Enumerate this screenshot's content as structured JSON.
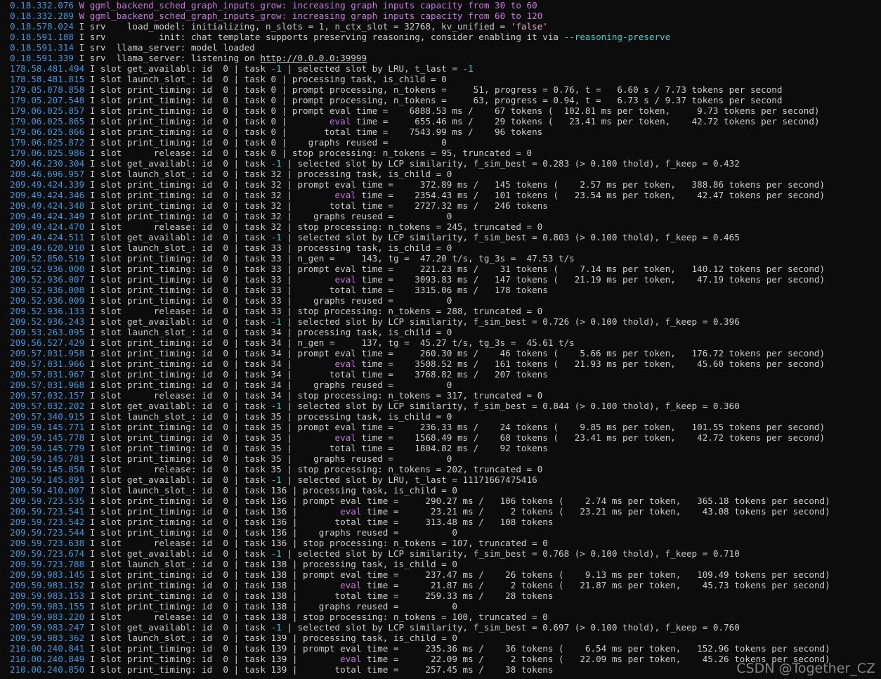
{
  "colors": {
    "background": "#0c0c0c",
    "timestamp": "#3a96dd",
    "warning": "#c678dd",
    "string_literal": "#f0a8c8",
    "keyword_cyan": "#3fd0d0",
    "text": "#cccccc"
  },
  "lines": [
    {
      "ts": "0.18.332.076",
      "lvl": "W",
      "segs": [
        {
          "t": " ggml_backend_sched_graph_inputs_grow: increasing graph inputs capacity from 30 to 60",
          "c": "warn"
        }
      ]
    },
    {
      "ts": "0.18.332.289",
      "lvl": "W",
      "segs": [
        {
          "t": " ggml_backend_sched_graph_inputs_grow: increasing graph inputs capacity from 60 to 120",
          "c": "warn"
        }
      ]
    },
    {
      "ts": "0.18.578.024",
      "lvl": "I",
      "segs": [
        {
          "t": " srv    load_model: initializing, n_slots = 1, n_ctx_slot = 32768, kv_unified = "
        },
        {
          "t": "'false'",
          "c": "str"
        }
      ]
    },
    {
      "ts": "0.18.591.188",
      "lvl": "I",
      "segs": [
        {
          "t": " srv          init: chat template supports preserving reasoning, consider enabling it via "
        },
        {
          "t": "--reasoning-preserve",
          "c": "cyan"
        }
      ]
    },
    {
      "ts": "0.18.591.314",
      "lvl": "I",
      "segs": [
        {
          "t": " srv  llama_server: model loaded"
        }
      ]
    },
    {
      "ts": "0.18.591.339",
      "lvl": "I",
      "segs": [
        {
          "t": " srv  llama_server: listening on "
        },
        {
          "t": "http://0.0.0.0:39999",
          "c": "url"
        }
      ]
    },
    {
      "ts": "178.58.481.494",
      "lvl": "I",
      "segs": [
        {
          "t": " slot get_availabl: id  0 | task "
        },
        {
          "t": "-1",
          "c": "cyan"
        },
        {
          "t": " | selected slot by LRU, t_last = "
        },
        {
          "t": "-1",
          "c": "cyan"
        }
      ]
    },
    {
      "ts": "178.58.481.815",
      "lvl": "I",
      "segs": [
        {
          "t": " slot launch_slot_: id  0 | task 0 | processing task, is_child = 0"
        }
      ]
    },
    {
      "ts": "179.05.078.858",
      "lvl": "I",
      "segs": [
        {
          "t": " slot print_timing: id  0 | task 0 | prompt processing, n_tokens =     51, progress = 0.76, t =   6.60 s / 7.73 tokens per second"
        }
      ]
    },
    {
      "ts": "179.05.207.548",
      "lvl": "I",
      "segs": [
        {
          "t": " slot print_timing: id  0 | task 0 | prompt processing, n_tokens =     63, progress = 0.94, t =   6.73 s / 9.37 tokens per second"
        }
      ]
    },
    {
      "ts": "179.06.025.857",
      "lvl": "I",
      "segs": [
        {
          "t": " slot print_timing: id  0 | task 0 | prompt eval time =    6888.53 ms /    67 tokens (  102.81 ms per token,     9.73 tokens per second)"
        }
      ]
    },
    {
      "ts": "179.06.025.865",
      "lvl": "I",
      "segs": [
        {
          "t": " slot print_timing: id  0 | task 0 |        "
        },
        {
          "t": "eval",
          "c": "warn"
        },
        {
          "t": " time =     655.46 ms /    29 tokens (   23.41 ms per token,    42.72 tokens per second)"
        }
      ]
    },
    {
      "ts": "179.06.025.866",
      "lvl": "I",
      "segs": [
        {
          "t": " slot print_timing: id  0 | task 0 |       total time =    7543.99 ms /    96 tokens"
        }
      ]
    },
    {
      "ts": "179.06.025.872",
      "lvl": "I",
      "segs": [
        {
          "t": " slot print_timing: id  0 | task 0 |    graphs reused =          0"
        }
      ]
    },
    {
      "ts": "179.06.025.986",
      "lvl": "I",
      "segs": [
        {
          "t": " slot      release: id  0 | task 0 | stop processing: n_tokens = 95, truncated = 0"
        }
      ]
    },
    {
      "ts": "209.46.230.304",
      "lvl": "I",
      "segs": [
        {
          "t": " slot get_availabl: id  0 | task "
        },
        {
          "t": "-1",
          "c": "cyan"
        },
        {
          "t": " | selected slot by LCP similarity, f_sim_best = 0.283 (> 0.100 thold), f_keep = 0.432"
        }
      ]
    },
    {
      "ts": "209.46.696.957",
      "lvl": "I",
      "segs": [
        {
          "t": " slot launch_slot_: id  0 | task 32 | processing task, is_child = 0"
        }
      ]
    },
    {
      "ts": "209.49.424.339",
      "lvl": "I",
      "segs": [
        {
          "t": " slot print_timing: id  0 | task 32 | prompt eval time =     372.89 ms /   145 tokens (    2.57 ms per token,   388.86 tokens per second)"
        }
      ]
    },
    {
      "ts": "209.49.424.346",
      "lvl": "I",
      "segs": [
        {
          "t": " slot print_timing: id  0 | task 32 |        "
        },
        {
          "t": "eval",
          "c": "warn"
        },
        {
          "t": " time =    2354.43 ms /   101 tokens (   23.54 ms per token,    42.47 tokens per second)"
        }
      ]
    },
    {
      "ts": "209.49.424.348",
      "lvl": "I",
      "segs": [
        {
          "t": " slot print_timing: id  0 | task 32 |       total time =    2727.32 ms /   246 tokens"
        }
      ]
    },
    {
      "ts": "209.49.424.349",
      "lvl": "I",
      "segs": [
        {
          "t": " slot print_timing: id  0 | task 32 |    graphs reused =          0"
        }
      ]
    },
    {
      "ts": "209.49.424.470",
      "lvl": "I",
      "segs": [
        {
          "t": " slot      release: id  0 | task 32 | stop processing: n_tokens = 245, truncated = 0"
        }
      ]
    },
    {
      "ts": "209.49.424.511",
      "lvl": "I",
      "segs": [
        {
          "t": " slot get_availabl: id  0 | task "
        },
        {
          "t": "-1",
          "c": "cyan"
        },
        {
          "t": " | selected slot by LCP similarity, f_sim_best = 0.803 (> 0.100 thold), f_keep = 0.465"
        }
      ]
    },
    {
      "ts": "209.49.620.910",
      "lvl": "I",
      "segs": [
        {
          "t": " slot launch_slot_: id  0 | task 33 | processing task, is_child = 0"
        }
      ]
    },
    {
      "ts": "209.52.850.519",
      "lvl": "I",
      "segs": [
        {
          "t": " slot print_timing: id  0 | task 33 | n_gen =     143, tg =  47.20 t/s, tg_3s =  47.53 t/s"
        }
      ]
    },
    {
      "ts": "209.52.936.000",
      "lvl": "I",
      "segs": [
        {
          "t": " slot print_timing: id  0 | task 33 | prompt eval time =     221.23 ms /    31 tokens (    7.14 ms per token,   140.12 tokens per second)"
        }
      ]
    },
    {
      "ts": "209.52.936.007",
      "lvl": "I",
      "segs": [
        {
          "t": " slot print_timing: id  0 | task 33 |        "
        },
        {
          "t": "eval",
          "c": "warn"
        },
        {
          "t": " time =    3093.83 ms /   147 tokens (   21.19 ms per token,    47.19 tokens per second)"
        }
      ]
    },
    {
      "ts": "209.52.936.008",
      "lvl": "I",
      "segs": [
        {
          "t": " slot print_timing: id  0 | task 33 |       total time =    3315.06 ms /   178 tokens"
        }
      ]
    },
    {
      "ts": "209.52.936.009",
      "lvl": "I",
      "segs": [
        {
          "t": " slot print_timing: id  0 | task 33 |    graphs reused =          0"
        }
      ]
    },
    {
      "ts": "209.52.936.133",
      "lvl": "I",
      "segs": [
        {
          "t": " slot      release: id  0 | task 33 | stop processing: n_tokens = 288, truncated = 0"
        }
      ]
    },
    {
      "ts": "209.52.936.243",
      "lvl": "I",
      "segs": [
        {
          "t": " slot get_availabl: id  0 | task "
        },
        {
          "t": "-1",
          "c": "cyan"
        },
        {
          "t": " | selected slot by LCP similarity, f_sim_best = 0.726 (> 0.100 thold), f_keep = 0.396"
        }
      ]
    },
    {
      "ts": "209.53.263.095",
      "lvl": "I",
      "segs": [
        {
          "t": " slot launch_slot_: id  0 | task 34 | processing task, is_child = 0"
        }
      ]
    },
    {
      "ts": "209.56.527.429",
      "lvl": "I",
      "segs": [
        {
          "t": " slot print_timing: id  0 | task 34 | n_gen =     137, tg =  45.27 t/s, tg_3s =  45.61 t/s"
        }
      ]
    },
    {
      "ts": "209.57.031.958",
      "lvl": "I",
      "segs": [
        {
          "t": " slot print_timing: id  0 | task 34 | prompt eval time =     260.30 ms /    46 tokens (    5.66 ms per token,   176.72 tokens per second)"
        }
      ]
    },
    {
      "ts": "209.57.031.966",
      "lvl": "I",
      "segs": [
        {
          "t": " slot print_timing: id  0 | task 34 |        "
        },
        {
          "t": "eval",
          "c": "warn"
        },
        {
          "t": " time =    3508.52 ms /   161 tokens (   21.93 ms per token,    45.60 tokens per second)"
        }
      ]
    },
    {
      "ts": "209.57.031.967",
      "lvl": "I",
      "segs": [
        {
          "t": " slot print_timing: id  0 | task 34 |       total time =    3768.82 ms /   207 tokens"
        }
      ]
    },
    {
      "ts": "209.57.031.968",
      "lvl": "I",
      "segs": [
        {
          "t": " slot print_timing: id  0 | task 34 |    graphs reused =          0"
        }
      ]
    },
    {
      "ts": "209.57.032.157",
      "lvl": "I",
      "segs": [
        {
          "t": " slot      release: id  0 | task 34 | stop processing: n_tokens = 317, truncated = 0"
        }
      ]
    },
    {
      "ts": "209.57.032.202",
      "lvl": "I",
      "segs": [
        {
          "t": " slot get_availabl: id  0 | task "
        },
        {
          "t": "-1",
          "c": "cyan"
        },
        {
          "t": " | selected slot by LCP similarity, f_sim_best = 0.844 (> 0.100 thold), f_keep = 0.360"
        }
      ]
    },
    {
      "ts": "209.57.340.915",
      "lvl": "I",
      "segs": [
        {
          "t": " slot launch_slot_: id  0 | task 35 | processing task, is_child = 0"
        }
      ]
    },
    {
      "ts": "209.59.145.771",
      "lvl": "I",
      "segs": [
        {
          "t": " slot print_timing: id  0 | task 35 | prompt eval time =     236.33 ms /    24 tokens (    9.85 ms per token,   101.55 tokens per second)"
        }
      ]
    },
    {
      "ts": "209.59.145.778",
      "lvl": "I",
      "segs": [
        {
          "t": " slot print_timing: id  0 | task 35 |        "
        },
        {
          "t": "eval",
          "c": "warn"
        },
        {
          "t": " time =    1568.49 ms /    68 tokens (   23.41 ms per token,    42.72 tokens per second)"
        }
      ]
    },
    {
      "ts": "209.59.145.779",
      "lvl": "I",
      "segs": [
        {
          "t": " slot print_timing: id  0 | task 35 |       total time =    1804.82 ms /    92 tokens"
        }
      ]
    },
    {
      "ts": "209.59.145.781",
      "lvl": "I",
      "segs": [
        {
          "t": " slot print_timing: id  0 | task 35 |    graphs reused =          0"
        }
      ]
    },
    {
      "ts": "209.59.145.858",
      "lvl": "I",
      "segs": [
        {
          "t": " slot      release: id  0 | task 35 | stop processing: n_tokens = 202, truncated = 0"
        }
      ]
    },
    {
      "ts": "209.59.145.891",
      "lvl": "I",
      "segs": [
        {
          "t": " slot get_availabl: id  0 | task "
        },
        {
          "t": "-1",
          "c": "cyan"
        },
        {
          "t": " | selected slot by LRU, t_last = 11171667475416"
        }
      ]
    },
    {
      "ts": "209.59.410.007",
      "lvl": "I",
      "segs": [
        {
          "t": " slot launch_slot_: id  0 | task 136 | processing task, is_child = 0"
        }
      ]
    },
    {
      "ts": "209.59.723.535",
      "lvl": "I",
      "segs": [
        {
          "t": " slot print_timing: id  0 | task 136 | prompt eval time =     290.27 ms /   106 tokens (    2.74 ms per token,   365.18 tokens per second)"
        }
      ]
    },
    {
      "ts": "209.59.723.541",
      "lvl": "I",
      "segs": [
        {
          "t": " slot print_timing: id  0 | task 136 |        "
        },
        {
          "t": "eval",
          "c": "warn"
        },
        {
          "t": " time =      23.21 ms /     2 tokens (   23.21 ms per token,    43.08 tokens per second)"
        }
      ]
    },
    {
      "ts": "209.59.723.542",
      "lvl": "I",
      "segs": [
        {
          "t": " slot print_timing: id  0 | task 136 |       total time =     313.48 ms /   108 tokens"
        }
      ]
    },
    {
      "ts": "209.59.723.544",
      "lvl": "I",
      "segs": [
        {
          "t": " slot print_timing: id  0 | task 136 |    graphs reused =          0"
        }
      ]
    },
    {
      "ts": "209.59.723.638",
      "lvl": "I",
      "segs": [
        {
          "t": " slot      release: id  0 | task 136 | stop processing: n_tokens = 107, truncated = 0"
        }
      ]
    },
    {
      "ts": "209.59.723.674",
      "lvl": "I",
      "segs": [
        {
          "t": " slot get_availabl: id  0 | task "
        },
        {
          "t": "-1",
          "c": "cyan"
        },
        {
          "t": " | selected slot by LCP similarity, f_sim_best = 0.768 (> 0.100 thold), f_keep = 0.710"
        }
      ]
    },
    {
      "ts": "209.59.723.788",
      "lvl": "I",
      "segs": [
        {
          "t": " slot launch_slot_: id  0 | task 138 | processing task, is_child = 0"
        }
      ]
    },
    {
      "ts": "209.59.983.145",
      "lvl": "I",
      "segs": [
        {
          "t": " slot print_timing: id  0 | task 138 | prompt eval time =     237.47 ms /    26 tokens (    9.13 ms per token,   109.49 tokens per second)"
        }
      ]
    },
    {
      "ts": "209.59.983.152",
      "lvl": "I",
      "segs": [
        {
          "t": " slot print_timing: id  0 | task 138 |        "
        },
        {
          "t": "eval",
          "c": "warn"
        },
        {
          "t": " time =      21.87 ms /     2 tokens (   21.87 ms per token,    45.73 tokens per second)"
        }
      ]
    },
    {
      "ts": "209.59.983.153",
      "lvl": "I",
      "segs": [
        {
          "t": " slot print_timing: id  0 | task 138 |       total time =     259.33 ms /    28 tokens"
        }
      ]
    },
    {
      "ts": "209.59.983.155",
      "lvl": "I",
      "segs": [
        {
          "t": " slot print_timing: id  0 | task 138 |    graphs reused =          0"
        }
      ]
    },
    {
      "ts": "209.59.983.220",
      "lvl": "I",
      "segs": [
        {
          "t": " slot      release: id  0 | task 138 | stop processing: n_tokens = 100, truncated = 0"
        }
      ]
    },
    {
      "ts": "209.59.983.247",
      "lvl": "I",
      "segs": [
        {
          "t": " slot get_availabl: id  0 | task "
        },
        {
          "t": "-1",
          "c": "cyan"
        },
        {
          "t": " | selected slot by LCP similarity, f_sim_best = 0.697 (> 0.100 thold), f_keep = 0.760"
        }
      ]
    },
    {
      "ts": "209.59.983.362",
      "lvl": "I",
      "segs": [
        {
          "t": " slot launch_slot_: id  0 | task 139 | processing task, is_child = 0"
        }
      ]
    },
    {
      "ts": "210.00.240.841",
      "lvl": "I",
      "segs": [
        {
          "t": " slot print_timing: id  0 | task 139 | prompt eval time =     235.36 ms /    36 tokens (    6.54 ms per token,   152.96 tokens per second)"
        }
      ]
    },
    {
      "ts": "210.00.240.849",
      "lvl": "I",
      "segs": [
        {
          "t": " slot print_timing: id  0 | task 139 |        "
        },
        {
          "t": "eval",
          "c": "warn"
        },
        {
          "t": " time =      22.09 ms /     2 tokens (   22.09 ms per token,    45.26 tokens per second)"
        }
      ]
    },
    {
      "ts": "210.00.240.850",
      "lvl": "I",
      "segs": [
        {
          "t": " slot print_timing: id  0 | task 139 |       total time =     257.45 ms /    38 tokens"
        }
      ]
    }
  ],
  "watermark": "CSDN @Together_CZ"
}
